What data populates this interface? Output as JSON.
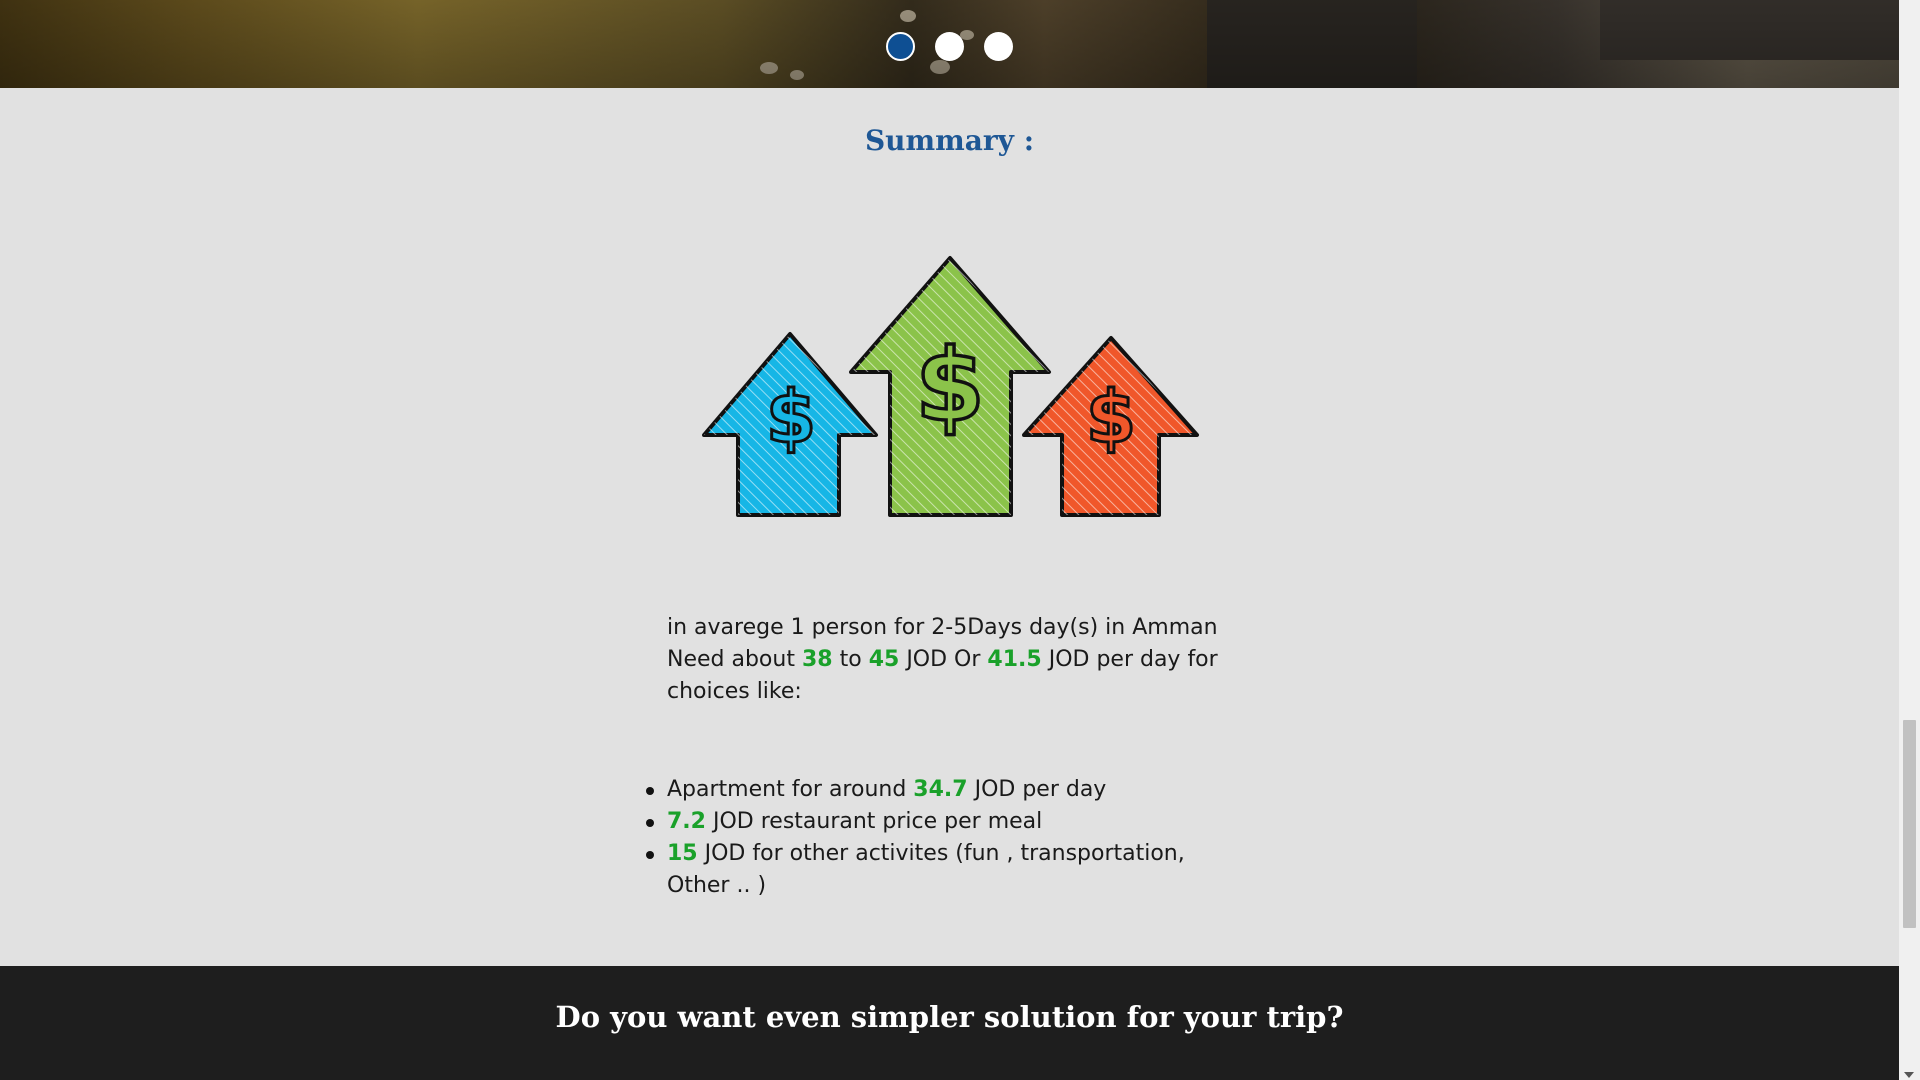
{
  "carousel": {
    "slide_count": 3,
    "active_index": 0
  },
  "summary": {
    "title": "Summary :",
    "illustration": "money-up-arrows-icon",
    "intro": {
      "line1": "in avarege 1 person for 2-5Days day(s) in Amman",
      "line2_prefix": "Need about",
      "min": "38",
      "to": "to",
      "max": "45",
      "mid1": "JOD Or",
      "avg": "41.5",
      "mid2": "JOD per day for",
      "line3": "choices like:"
    },
    "items": [
      {
        "prefix": "Apartment for around",
        "value": "34.7",
        "suffix": "JOD per day"
      },
      {
        "prefix": "",
        "value": "7.2",
        "suffix": "JOD restaurant price per meal"
      },
      {
        "prefix": "",
        "value": "15",
        "suffix": "JOD for other activites (fun , transportation,",
        "line2": "Other .. )"
      }
    ]
  },
  "footer": {
    "title": "Do you want even simpler solution for your trip?"
  },
  "colors": {
    "accent_blue": "#1e5795",
    "highlight_green": "#1aa12a",
    "arrow_blue": "#16b6e6",
    "arrow_green": "#8bc34a",
    "arrow_red": "#f0572a"
  }
}
